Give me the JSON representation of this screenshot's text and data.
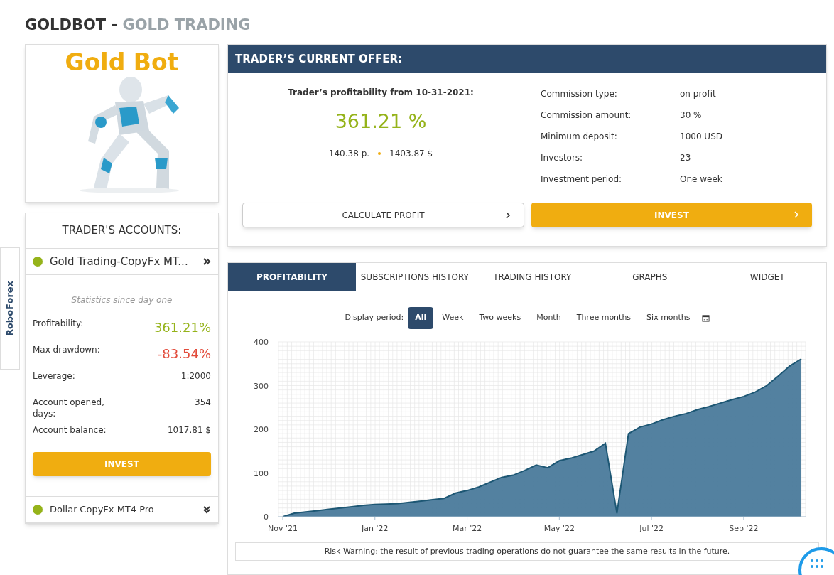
{
  "page_title": {
    "main": "GOLDBOT -",
    "sub": "GOLD TRADING"
  },
  "side_tab": {
    "label": "RoboForex"
  },
  "trader_card": {
    "name": "Gold Bot"
  },
  "accounts": {
    "title": "TRADER'S ACCOUNTS:",
    "items": [
      {
        "name": "Gold Trading-CopyFx MT...",
        "color": "#95b31a",
        "expanded": true,
        "caption": "Statistics since day one",
        "stats": [
          {
            "label": "Profitability:",
            "value": "361.21%",
            "kind": "positive"
          },
          {
            "label": "Max drawdown:",
            "value": "-83.54%",
            "kind": "negative"
          },
          {
            "label": "Leverage:",
            "value": "1:2000",
            "kind": "plain"
          },
          {
            "label": "Account opened, days:",
            "value": "354",
            "kind": "plain"
          },
          {
            "label": "Account balance:",
            "value": "1017.81 $",
            "kind": "plain"
          }
        ],
        "button": "INVEST"
      },
      {
        "name": "Dollar-CopyFx MT4 Pro",
        "color": "#95b31a",
        "expanded": false
      }
    ]
  },
  "offer": {
    "title": "TRADER’S CURRENT OFFER:",
    "profitability_label": "Trader’s profitability from 10-31-2021:",
    "profitability": "361.21 %",
    "points": "140.38 p.",
    "amount": "1403.87 $",
    "details": [
      {
        "label": "Commission type:",
        "value": "on profit"
      },
      {
        "label": "Commission amount:",
        "value": "30 %"
      },
      {
        "label": "Minimum deposit:",
        "value": "1000 USD"
      },
      {
        "label": "Investors:",
        "value": "23"
      },
      {
        "label": "Investment period:",
        "value": "One week"
      }
    ],
    "buttons": [
      {
        "label": "CALCULATE PROFIT",
        "kind": "secondary"
      },
      {
        "label": "INVEST",
        "kind": "primary"
      }
    ]
  },
  "tabs": [
    {
      "label": "PROFITABILITY",
      "selected": true
    },
    {
      "label": "SUBSCRIPTIONS HISTORY",
      "selected": false
    },
    {
      "label": "TRADING HISTORY",
      "selected": false
    },
    {
      "label": "GRAPHS",
      "selected": false
    },
    {
      "label": "WIDGET",
      "selected": false
    }
  ],
  "period": {
    "label": "Display period:",
    "options": [
      {
        "label": "All",
        "selected": true
      },
      {
        "label": "Week",
        "selected": false
      },
      {
        "label": "Two weeks",
        "selected": false
      },
      {
        "label": "Month",
        "selected": false
      },
      {
        "label": "Three months",
        "selected": false
      },
      {
        "label": "Six months",
        "selected": false
      }
    ]
  },
  "chart_data": {
    "type": "area",
    "categories": [
      "Nov '21",
      null,
      null,
      null,
      null,
      null,
      null,
      null,
      "Jan '22",
      null,
      null,
      null,
      null,
      null,
      null,
      null,
      "Mar '22",
      null,
      null,
      null,
      null,
      null,
      null,
      null,
      "May '22",
      null,
      null,
      null,
      null,
      null,
      null,
      null,
      "Jul '22",
      null,
      null,
      null,
      null,
      null,
      null,
      null,
      "Sep '22",
      null,
      null,
      null,
      null,
      null
    ],
    "series": [
      {
        "color": "#4a7a9b",
        "values": [
          0,
          8,
          11,
          14,
          17,
          20,
          23,
          26,
          28,
          29,
          30,
          33,
          36,
          39,
          42,
          54,
          60,
          68,
          79,
          90,
          95,
          106,
          118,
          112,
          128,
          134,
          142,
          150,
          168,
          8,
          190,
          205,
          212,
          222,
          230,
          236,
          245,
          252,
          260,
          268,
          275,
          285,
          300,
          322,
          345,
          361
        ]
      }
    ],
    "ylim": [
      0,
      400
    ],
    "yticks": [
      0,
      100,
      200,
      300,
      400
    ],
    "grid": true
  },
  "risk_warning": "Risk Warning: the result of previous trading operations do not guarantee the same results in the future."
}
